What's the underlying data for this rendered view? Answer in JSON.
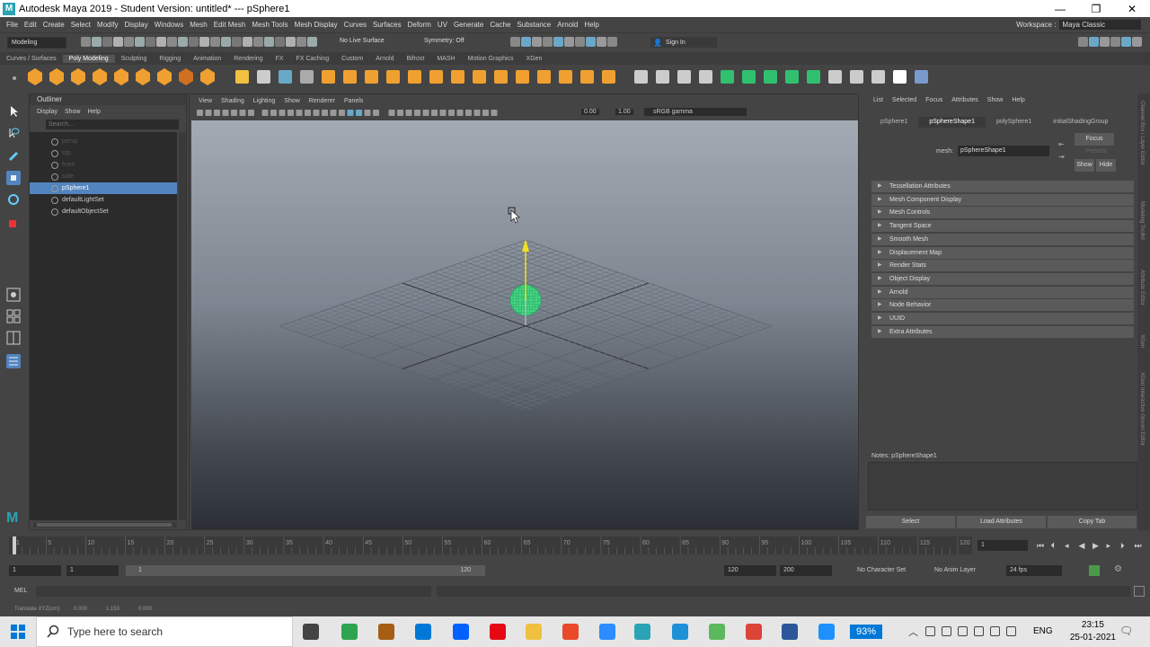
{
  "window": {
    "title": "Autodesk Maya 2019 - Student Version: untitled*   ---   pSphere1"
  },
  "menus": [
    "File",
    "Edit",
    "Create",
    "Select",
    "Modify",
    "Display",
    "Windows",
    "Mesh",
    "Edit Mesh",
    "Mesh Tools",
    "Mesh Display",
    "Curves",
    "Surfaces",
    "Deform",
    "UV",
    "Generate",
    "Cache",
    "Substance",
    "Arnold",
    "Help"
  ],
  "workspace": {
    "label": "Workspace :",
    "value": "Maya Classic"
  },
  "statusline": {
    "mode": "Modeling",
    "live_surface": "No Live Surface",
    "symmetry": "Symmetry: Off",
    "sign_in": "Sign In"
  },
  "shelf_tabs": [
    "Curves / Surfaces",
    "Poly Modeling",
    "Sculpting",
    "Rigging",
    "Animation",
    "Rendering",
    "FX",
    "FX Caching",
    "Custom",
    "Arnold",
    "Bifrost",
    "MASH",
    "Motion Graphics",
    "XGen"
  ],
  "outliner": {
    "title": "Outliner",
    "menu": [
      "Display",
      "Show",
      "Help"
    ],
    "search_placeholder": "Search...",
    "items": [
      {
        "label": "persp",
        "state": "dim"
      },
      {
        "label": "top",
        "state": "dim"
      },
      {
        "label": "front",
        "state": "dim"
      },
      {
        "label": "side",
        "state": "dim"
      },
      {
        "label": "pSphere1",
        "state": "selected"
      },
      {
        "label": "defaultLightSet",
        "state": "normal"
      },
      {
        "label": "defaultObjectSet",
        "state": "normal"
      }
    ]
  },
  "viewport": {
    "menu": [
      "View",
      "Shading",
      "Lighting",
      "Show",
      "Renderer",
      "Panels"
    ],
    "exposure": "0.00",
    "gamma": "1.00",
    "color_space": "sRGB gamma"
  },
  "attribute_editor": {
    "menu": [
      "List",
      "Selected",
      "Focus",
      "Attributes",
      "Show",
      "Help"
    ],
    "tabs": [
      "pSphere1",
      "pSphereShape1",
      "polySphere1",
      "initialShadingGroup"
    ],
    "active_tab": "pSphereShape1",
    "mesh_label": "mesh:",
    "mesh_value": "pSphereShape1",
    "focus": "Focus",
    "presets": "Presets",
    "show": "Show",
    "hide": "Hide",
    "sections": [
      "Tessellation Attributes",
      "Mesh Component Display",
      "Mesh Controls",
      "Tangent Space",
      "Smooth Mesh",
      "Displacement Map",
      "Render Stats",
      "Object Display",
      "Arnold",
      "Node Behavior",
      "UUID",
      "Extra Attributes"
    ],
    "notes": "Notes:  pSphereShape1",
    "buttons": [
      "Select",
      "Load Attributes",
      "Copy Tab"
    ]
  },
  "side_strip": [
    "Channel Box / Layer Editor",
    "Modeling Toolkit",
    "Attribute Editor",
    "XGen",
    "XGen Interactive Groom Editor"
  ],
  "timeline": {
    "ticks": [
      "1",
      "5",
      "10",
      "15",
      "20",
      "25",
      "30",
      "35",
      "40",
      "45",
      "50",
      "55",
      "60",
      "65",
      "70",
      "75",
      "80",
      "85",
      "90",
      "95",
      "100",
      "105",
      "110",
      "115",
      "120"
    ],
    "current_frame": "1"
  },
  "range": {
    "start": "1",
    "start_inner": "1",
    "slider_start": "1",
    "slider_end": "120",
    "end_inner": "120",
    "end": "200",
    "character_set": "No Character Set",
    "anim_layer": "No Anim Layer",
    "fps": "24 fps"
  },
  "command": {
    "label": "MEL"
  },
  "help_line": {
    "text": "Translate XYZ(cm):",
    "x": "0.000",
    "y": "1.153",
    "z": "0.000"
  },
  "taskbar": {
    "search_placeholder": "Type here to search",
    "battery": "93%",
    "language": "ENG",
    "time": "23:15",
    "date": "25-01-2021"
  }
}
